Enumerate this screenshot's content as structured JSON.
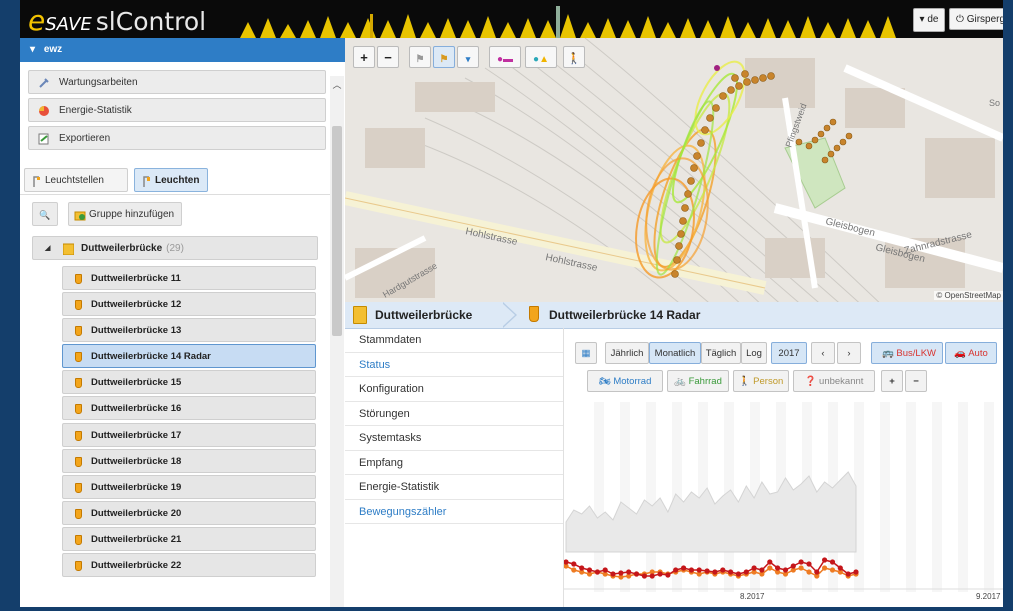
{
  "app": {
    "logo_e": "e",
    "logo_save": "SAVE",
    "logo_name": "slControl",
    "lang": "▾ de",
    "user": "Girsperger"
  },
  "sidebar": {
    "group": "ewz",
    "menu": [
      {
        "label": "Wartungsarbeiten",
        "icon": "wrench-icon"
      },
      {
        "label": "Energie-Statistik",
        "icon": "energy-icon"
      },
      {
        "label": "Exportieren",
        "icon": "export-icon"
      }
    ],
    "tabs": [
      {
        "label": "Leuchtstellen"
      },
      {
        "label": "Leuchten"
      }
    ],
    "search_icon": "🔍",
    "add_group": "Gruppe hinzufügen",
    "tree_group": {
      "label": "Duttweilerbrücke",
      "count": "(29)"
    },
    "items": [
      "Duttweilerbrücke 11",
      "Duttweilerbrücke 12",
      "Duttweilerbrücke 13",
      "Duttweilerbrücke 14 Radar",
      "Duttweilerbrücke 15",
      "Duttweilerbrücke 16",
      "Duttweilerbrücke 17",
      "Duttweilerbrücke 18",
      "Duttweilerbrücke 19",
      "Duttweilerbrücke 20",
      "Duttweilerbrücke 21",
      "Duttweilerbrücke 22"
    ],
    "selected_index": 3
  },
  "map": {
    "streets": [
      "Hohlstrasse",
      "Hohlstrasse",
      "Gleisbogen",
      "Gleisbogen",
      "Zahnradstrasse",
      "Pfingstweid",
      "Hardgutstrasse",
      "So"
    ],
    "attribution": "© OpenStreetMap"
  },
  "detail": {
    "crumb_group": "Duttweilerbrücke",
    "crumb_item": "Duttweilerbrücke 14 Radar",
    "subnav": [
      {
        "label": "Stammdaten",
        "state": "normal"
      },
      {
        "label": "Status",
        "state": "active"
      },
      {
        "label": "Konfiguration",
        "state": "normal"
      },
      {
        "label": "Störungen",
        "state": "normal"
      },
      {
        "label": "Systemtasks",
        "state": "normal"
      },
      {
        "label": "Empfang",
        "state": "normal"
      },
      {
        "label": "Energie-Statistik",
        "state": "normal"
      },
      {
        "label": "Bewegungszähler",
        "state": "link"
      }
    ],
    "period_buttons": [
      "Jährlich",
      "Monatlich",
      "Täglich",
      "Log"
    ],
    "period_active": "Monatlich",
    "year": "2017",
    "prev": "‹",
    "next": "›",
    "filters_row1": [
      "Bus/LKW",
      "Auto"
    ],
    "filters_row2": [
      "Motorrad",
      "Fahrrad",
      "Person",
      "unbekannt"
    ],
    "zoom_in": "+",
    "zoom_out": "−",
    "axis_labels": [
      "8.2017",
      "9.2017"
    ]
  },
  "colors": {
    "header": "#0a0a0a",
    "accent": "#2e7dc6",
    "series_red": "#c5161a",
    "series_orange": "#ee7b22",
    "range_fill": "#e9e9e9"
  }
}
